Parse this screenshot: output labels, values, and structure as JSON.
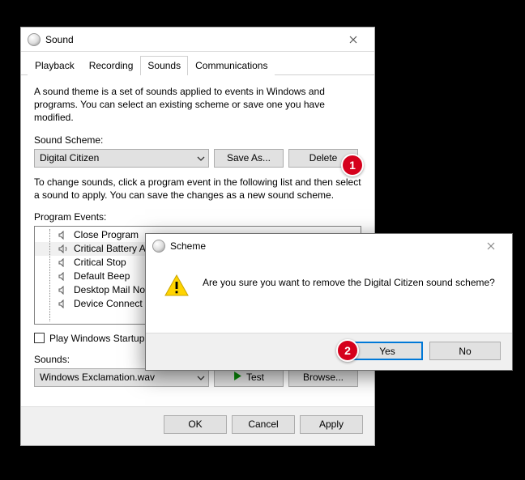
{
  "sound": {
    "title": "Sound",
    "tabs": {
      "playback": "Playback",
      "recording": "Recording",
      "sounds": "Sounds",
      "communications": "Communications"
    },
    "theme_desc": "A sound theme is a set of sounds applied to events in Windows and programs.  You can select an existing scheme or save one you have modified.",
    "scheme_label": "Sound Scheme:",
    "scheme_value": "Digital Citizen",
    "save_as": "Save As...",
    "delete": "Delete",
    "change_desc": "To change sounds, click a program event in the following list and then select a sound to apply.  You can save the changes as a new sound scheme.",
    "events_label": "Program Events:",
    "events": [
      "Close Program",
      "Critical Battery Al",
      "Critical Stop",
      "Default Beep",
      "Desktop Mail No",
      "Device Connect"
    ],
    "startup_label": "Play Windows Startup",
    "sounds_label": "Sounds:",
    "sounds_value": "Windows Exclamation.wav",
    "test": "Test",
    "browse": "Browse...",
    "ok": "OK",
    "cancel": "Cancel",
    "apply": "Apply"
  },
  "scheme": {
    "title": "Scheme",
    "message": "Are you sure you want to remove the Digital Citizen sound scheme?",
    "yes": "Yes",
    "no": "No"
  },
  "badges": {
    "b1": "1",
    "b2": "2"
  }
}
